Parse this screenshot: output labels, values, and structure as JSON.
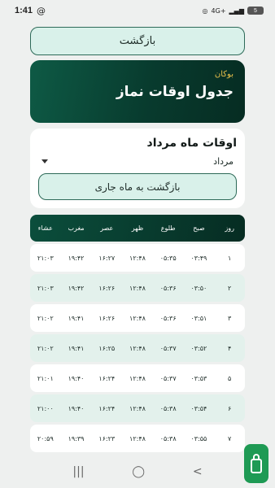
{
  "status": {
    "time": "1:41",
    "network": "4G+",
    "battery": "5"
  },
  "back_button": "بازگشت",
  "header": {
    "brand": "بوکان",
    "title": "جدول اوقات نماز"
  },
  "month_card": {
    "title": "اوقات ماه مرداد",
    "selected_month": "مرداد",
    "current_month_button": "بازگشت به ماه جاری"
  },
  "table": {
    "headers": [
      "روز",
      "صبح",
      "طلوع",
      "ظهر",
      "عصر",
      "مغرب",
      "عشاء"
    ],
    "rows": [
      [
        "۱",
        "۰۳:۴۹",
        "۰۵:۳۵",
        "۱۲:۴۸",
        "۱۶:۲۷",
        "۱۹:۴۲",
        "۲۱:۰۳"
      ],
      [
        "۲",
        "۰۳:۵۰",
        "۰۵:۳۶",
        "۱۲:۴۸",
        "۱۶:۲۶",
        "۱۹:۴۲",
        "۲۱:۰۳"
      ],
      [
        "۳",
        "۰۳:۵۱",
        "۰۵:۳۶",
        "۱۲:۴۸",
        "۱۶:۲۶",
        "۱۹:۴۱",
        "۲۱:۰۲"
      ],
      [
        "۴",
        "۰۳:۵۲",
        "۰۵:۳۷",
        "۱۲:۴۸",
        "۱۶:۲۵",
        "۱۹:۴۱",
        "۲۱:۰۲"
      ],
      [
        "۵",
        "۰۳:۵۳",
        "۰۵:۳۷",
        "۱۲:۴۸",
        "۱۶:۲۴",
        "۱۹:۴۰",
        "۲۱:۰۱"
      ],
      [
        "۶",
        "۰۳:۵۴",
        "۰۵:۳۸",
        "۱۲:۴۸",
        "۱۶:۲۴",
        "۱۹:۴۰",
        "۲۱:۰۰"
      ],
      [
        "۷",
        "۰۳:۵۵",
        "۰۵:۳۸",
        "۱۲:۴۸",
        "۱۶:۲۳",
        "۱۹:۳۹",
        "۲۰:۵۹"
      ]
    ]
  },
  "nav": {
    "recents_icon": "|||",
    "home_icon": "◯",
    "back_icon": "<"
  }
}
